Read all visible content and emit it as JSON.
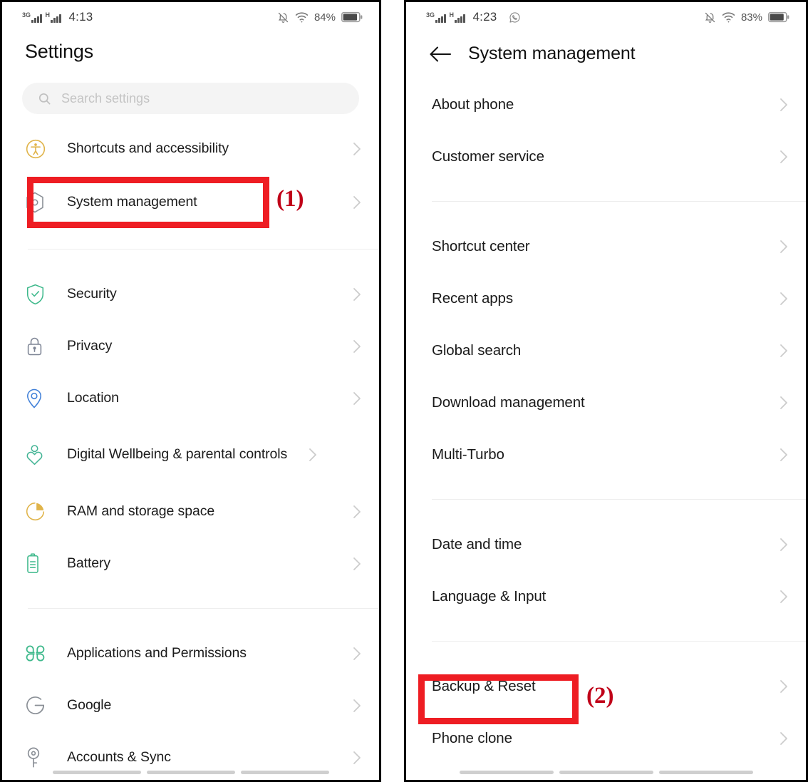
{
  "left_phone": {
    "status_bar": {
      "network_1": "3G",
      "network_2": "H",
      "time": "4:13",
      "battery_percent": "84%",
      "icons": [
        "signal-bars-icon",
        "signal-bars-icon",
        "bell-muted-icon",
        "wifi-icon",
        "battery-icon"
      ]
    },
    "title": "Settings",
    "search": {
      "placeholder": "Search settings",
      "icon": "search-icon"
    },
    "items": [
      {
        "label": "Shortcuts and accessibility",
        "icon": "accessibility-icon",
        "color": "#e0b44a"
      },
      {
        "label": "System management",
        "icon": "hex-nut-icon",
        "color": "#8a8f96"
      },
      {
        "label": "Security",
        "icon": "shield-check-icon",
        "color": "#3fb98c"
      },
      {
        "label": "Privacy",
        "icon": "lock-icon",
        "color": "#7d8494"
      },
      {
        "label": "Location",
        "icon": "location-pin-icon",
        "color": "#3f7fd8"
      },
      {
        "label": "Digital Wellbeing & parental controls",
        "icon": "wellbeing-heart-icon",
        "color": "#45b596"
      },
      {
        "label": "RAM and storage space",
        "icon": "pie-chart-icon",
        "color": "#e0b44a"
      },
      {
        "label": "Battery",
        "icon": "battery-list-icon",
        "color": "#3fb98c"
      },
      {
        "label": "Applications and Permissions",
        "icon": "apps-grid-icon",
        "color": "#3fb98c"
      },
      {
        "label": "Google",
        "icon": "google-g-icon",
        "color": "#8a8f96"
      },
      {
        "label": "Accounts & Sync",
        "icon": "key-icon",
        "color": "#8a8f96"
      }
    ],
    "annotation": {
      "number": "(1)",
      "target_label": "System management",
      "color": "#ee1d23"
    }
  },
  "right_phone": {
    "status_bar": {
      "network_1": "3G",
      "network_2": "H",
      "time": "4:23",
      "battery_percent": "83%",
      "icons": [
        "signal-bars-icon",
        "signal-bars-icon",
        "whatsapp-icon",
        "bell-muted-icon",
        "wifi-icon",
        "battery-icon"
      ]
    },
    "back_icon": "arrow-left-icon",
    "title": "System management",
    "groups": [
      {
        "items": [
          {
            "label": "About phone"
          },
          {
            "label": "Customer service"
          }
        ]
      },
      {
        "items": [
          {
            "label": "Shortcut center"
          },
          {
            "label": "Recent apps"
          },
          {
            "label": "Global search"
          },
          {
            "label": "Download management"
          },
          {
            "label": "Multi-Turbo"
          }
        ]
      },
      {
        "items": [
          {
            "label": "Date and time"
          },
          {
            "label": "Language & Input"
          }
        ]
      },
      {
        "items": [
          {
            "label": "Backup & Reset"
          },
          {
            "label": "Phone clone"
          }
        ]
      }
    ],
    "annotation": {
      "number": "(2)",
      "target_label": "Backup & Reset",
      "color": "#ee1d23"
    }
  }
}
